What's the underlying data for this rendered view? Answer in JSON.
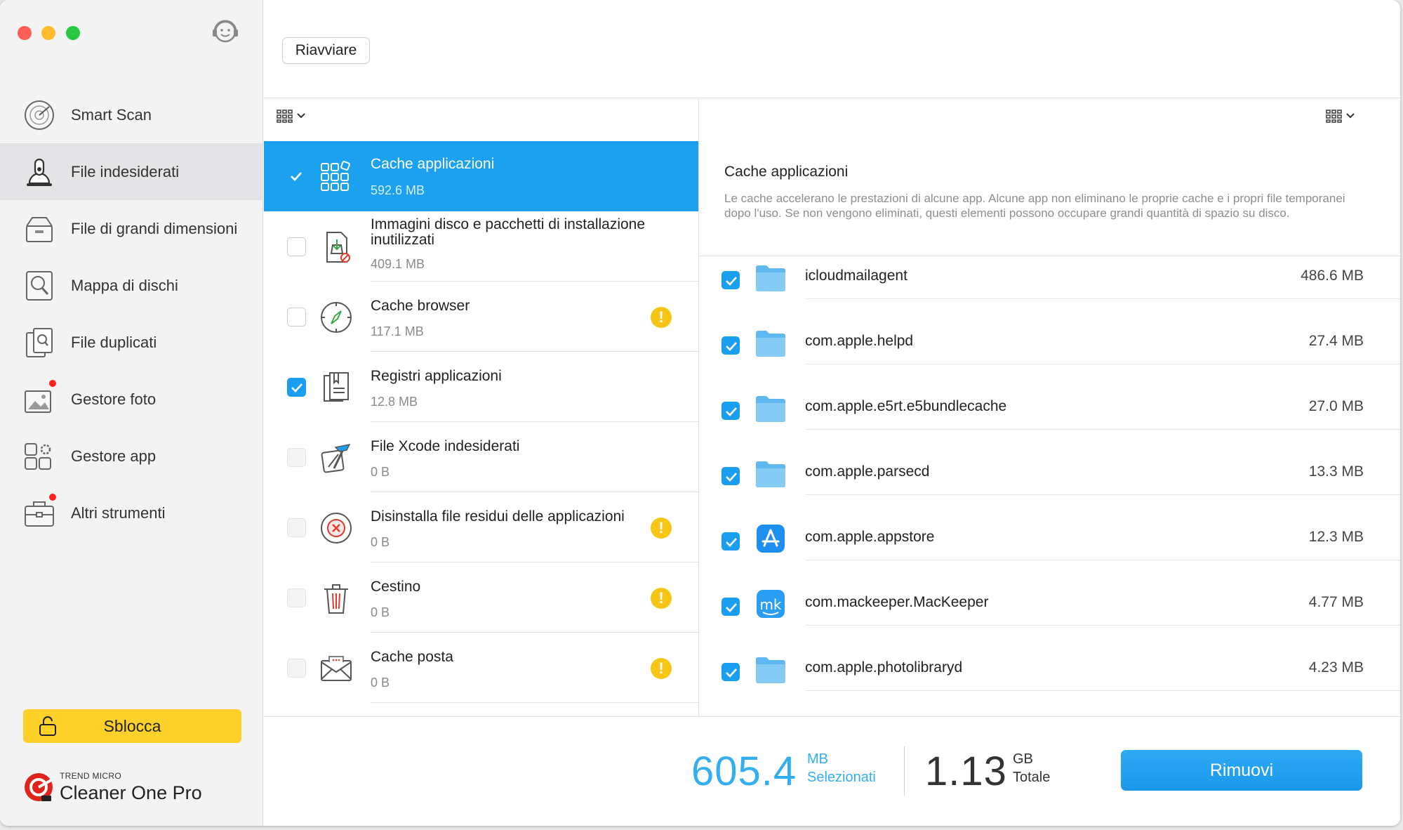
{
  "window": {
    "title": "Cleaner One Pro"
  },
  "sidebar": {
    "items": [
      {
        "label": "Smart Scan",
        "icon": "radar-icon"
      },
      {
        "label": "File indesiderati",
        "icon": "vacuum-icon",
        "active": true
      },
      {
        "label": "File di grandi dimensioni",
        "icon": "box-icon"
      },
      {
        "label": "Mappa di dischi",
        "icon": "disk-map-icon"
      },
      {
        "label": "File duplicati",
        "icon": "duplicate-icon"
      },
      {
        "label": "Gestore foto",
        "icon": "photo-icon",
        "badge": true
      },
      {
        "label": "Gestore app",
        "icon": "apps-icon"
      },
      {
        "label": "Altri strumenti",
        "icon": "toolbox-icon",
        "badge": true
      }
    ],
    "unlock_label": "Sblocca",
    "brand_small": "TREND MICRO",
    "brand_name": "Cleaner One Pro"
  },
  "toolbar": {
    "restart_label": "Riavviare"
  },
  "categories": [
    {
      "title": "Cache applicazioni",
      "size": "592.6 MB",
      "state": "checked",
      "active": true,
      "icon": "app-cache-icon",
      "warning": false
    },
    {
      "title": "Immagini disco e pacchetti di installazione inutilizzati",
      "size": "409.1 MB",
      "state": "unchecked",
      "icon": "disk-image-icon",
      "warning": false
    },
    {
      "title": "Cache browser",
      "size": "117.1 MB",
      "state": "unchecked",
      "icon": "compass-icon",
      "warning": true
    },
    {
      "title": "Registri applicazioni",
      "size": "12.8 MB",
      "state": "checked",
      "icon": "logs-icon",
      "warning": false
    },
    {
      "title": "File Xcode indesiderati",
      "size": "0 B",
      "state": "disabled",
      "icon": "xcode-icon",
      "warning": false
    },
    {
      "title": "Disinstalla file residui delle applicazioni",
      "size": "0 B",
      "state": "disabled",
      "icon": "uninstall-icon",
      "warning": true
    },
    {
      "title": "Cestino",
      "size": "0 B",
      "state": "disabled",
      "icon": "trash-icon",
      "warning": true
    },
    {
      "title": "Cache posta",
      "size": "0 B",
      "state": "disabled",
      "icon": "mail-icon",
      "warning": true
    }
  ],
  "detail": {
    "title": "Cache applicazioni",
    "description": "Le cache accelerano le prestazioni di alcune app. Alcune app non eliminano le proprie cache e i propri file temporanei dopo l'uso. Se non vengono eliminati, questi elementi possono occupare grandi quantità di spazio su disco."
  },
  "files": [
    {
      "name": "icloudmailagent",
      "size": "486.6 MB",
      "icon": "folder-icon"
    },
    {
      "name": "com.apple.helpd",
      "size": "27.4 MB",
      "icon": "folder-icon"
    },
    {
      "name": "com.apple.e5rt.e5bundlecache",
      "size": "27.0 MB",
      "icon": "folder-icon"
    },
    {
      "name": "com.apple.parsecd",
      "size": "13.3 MB",
      "icon": "folder-icon"
    },
    {
      "name": "com.apple.appstore",
      "size": "12.3 MB",
      "icon": "app-store-icon"
    },
    {
      "name": "com.mackeeper.MacKeeper",
      "size": "4.77 MB",
      "icon": "mackeeper-icon"
    },
    {
      "name": "com.apple.photolibraryd",
      "size": "4.23 MB",
      "icon": "folder-icon"
    }
  ],
  "footer": {
    "selected_value": "605.4",
    "selected_unit": "MB",
    "selected_label": "Selezionati",
    "total_value": "1.13",
    "total_unit": "GB",
    "total_label": "Totale",
    "remove_label": "Rimuovi"
  },
  "colors": {
    "accent": "#1ba1ef",
    "unlock": "#fdd12a",
    "warning": "#f7c514",
    "badge": "#ff1f1f"
  }
}
